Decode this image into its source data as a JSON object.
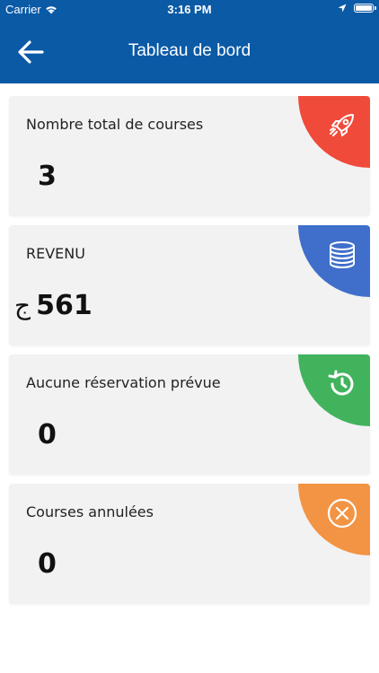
{
  "status_bar": {
    "carrier": "Carrier",
    "time": "3:16 PM"
  },
  "nav": {
    "title": "Tableau de bord"
  },
  "cards": [
    {
      "label": "Nombre total de courses",
      "value": "3",
      "color": "#f04a3a",
      "icon": "rocket-icon"
    },
    {
      "label": "REVENU",
      "value": "561",
      "currency": "ج",
      "color": "#3f6fcb",
      "icon": "coins-icon"
    },
    {
      "label": "Aucune réservation prévue",
      "value": "0",
      "color": "#41b35d",
      "icon": "history-icon"
    },
    {
      "label": "Courses annulées",
      "value": "0",
      "color": "#f29444",
      "icon": "cancel-circle-icon"
    }
  ],
  "colors": {
    "header": "#0a5aa6",
    "card_background": "#f2f2f2"
  }
}
